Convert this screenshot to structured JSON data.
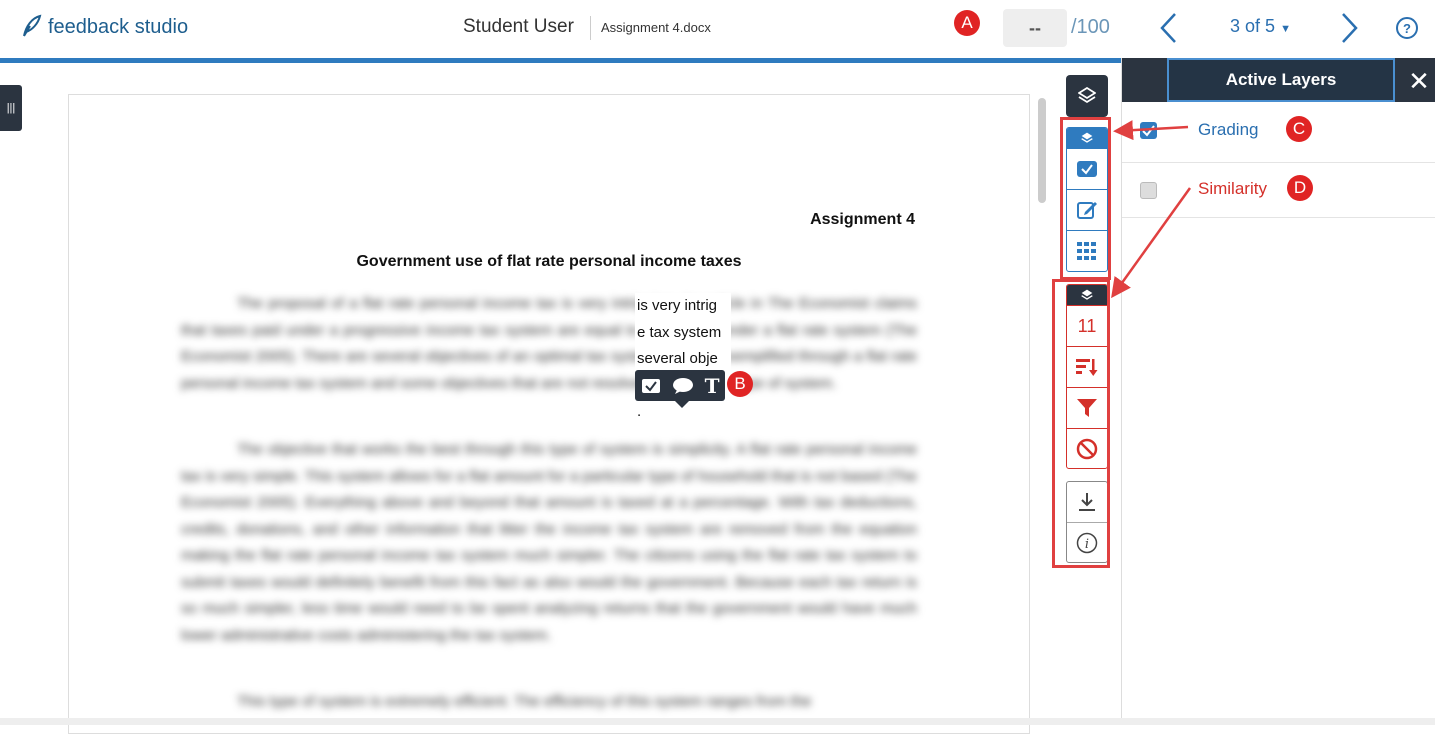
{
  "header": {
    "app_name": "feedback studio",
    "student_name": "Student User",
    "file_name": "Assignment 4.docx",
    "grade_value": "--",
    "grade_max": "/100",
    "page_counter": "3 of 5"
  },
  "callouts": {
    "a": "A",
    "b": "B",
    "c": "C",
    "d": "D"
  },
  "document": {
    "assignment_label": "Assignment 4",
    "title": "Government use of flat rate personal income taxes",
    "visible_fragments": [
      "is very intrig",
      "e tax system",
      "several obje",
      "."
    ],
    "paragraphs": [
      "The proposal of a flat rate personal income tax is very intriguing. An article in The Economist claims that taxes paid under a progressive income tax system are equal to those paid under a flat rate system (The Economist 2005). There are several objectives of an optimal tax system that are exemplified through a flat rate personal income tax system and some objectives that are not resolved through this type of system.",
      "The objective that works the best through this type of system is simplicity. A flat rate personal income tax is very simple. This system allows for a flat amount for a particular type of household that is not based (The Economist 2005). Everything above and beyond that amount is taxed at a percentage. With tax deductions, credits, donations, and other information that litter the income tax system are removed from the equation making the flat rate personal income tax system much simpler. The citizens using the flat rate tax system to submit taxes would definitely benefit from this fact as also would the government. Because each tax return is so much simpler, less time would need to be spent analyzing returns that the government would have much lower administrative costs administering the tax system.",
      "This type of system is extremely efficient. The efficiency of this system ranges from the"
    ]
  },
  "grading_tools": {
    "similarity_count": "11"
  },
  "panel": {
    "title": "Active Layers",
    "layers": [
      {
        "label": "Grading",
        "checked": true,
        "color": "#2a6fb0"
      },
      {
        "label": "Similarity",
        "checked": false,
        "color": "#d4302a"
      }
    ]
  },
  "colors": {
    "brand_blue": "#2f7bbf",
    "dark": "#2b3440",
    "similarity_red": "#d4302a",
    "callout_red": "#e02424"
  }
}
